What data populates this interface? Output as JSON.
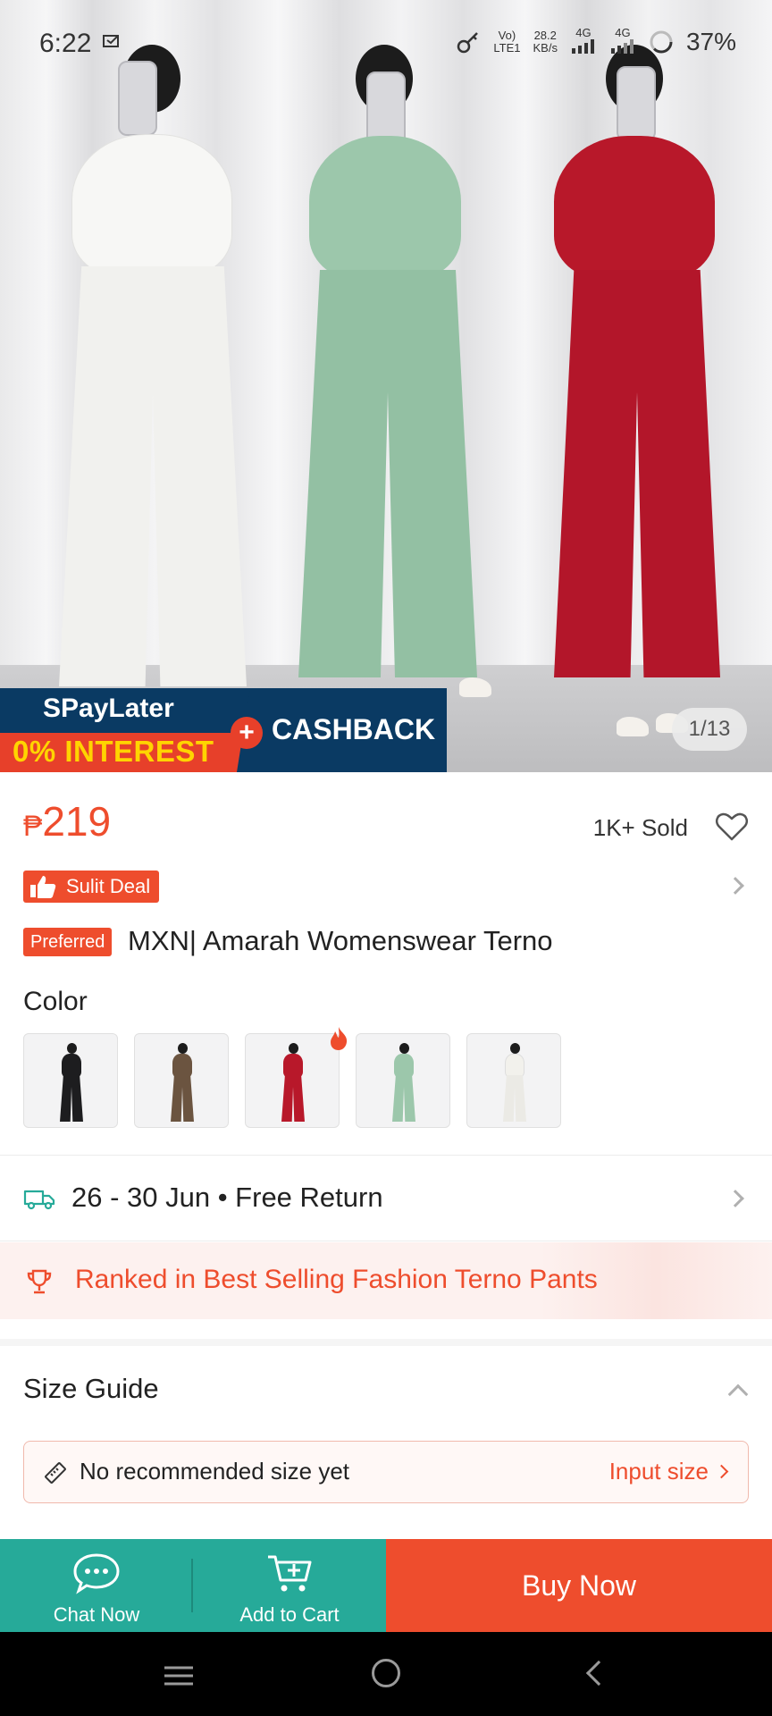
{
  "status_bar": {
    "time": "6:22",
    "volte_top": "Vo)",
    "volte_bottom": "LTE1",
    "speed_top": "28.2",
    "speed_bottom": "KB/s",
    "net1": "4G",
    "net2": "4G",
    "battery": "37%"
  },
  "hero": {
    "promo_spaylater": "SPayLater",
    "promo_interest": "0% INTEREST",
    "promo_plus": "+",
    "promo_cashback": "CASHBACK",
    "image_counter": "1/13",
    "variant_colors": [
      "#f7f7f5",
      "#9cc7ab",
      "#b8182a"
    ]
  },
  "product": {
    "currency": "₱",
    "price": "219",
    "sold": "1K+ Sold",
    "deal_label": "Sulit Deal",
    "preferred_label": "Preferred",
    "title": "MXN| Amarah Womenswear Terno",
    "color_label": "Color",
    "swatches": [
      {
        "name": "black",
        "color": "#1d1d1f"
      },
      {
        "name": "brown",
        "color": "#6b5440"
      },
      {
        "name": "red",
        "color": "#b8182a"
      },
      {
        "name": "mint",
        "color": "#9cc7ab"
      },
      {
        "name": "white",
        "color": "#f2f1ec"
      }
    ]
  },
  "delivery": {
    "text": "26 - 30 Jun • Free Return"
  },
  "ranking": {
    "text": "Ranked in Best Selling Fashion Terno Pants"
  },
  "size_guide": {
    "title": "Size Guide",
    "recommendation": "No recommended size yet",
    "input_link": "Input size"
  },
  "bottom_bar": {
    "chat_label": "Chat Now",
    "cart_label": "Add to Cart",
    "buy_label": "Buy Now"
  },
  "colors": {
    "accent": "#ee4d2d",
    "teal": "#26aa99",
    "promo_navy": "#0a3a63"
  },
  "icons": {
    "heart": "heart-icon",
    "deal": "thumbs-up-icon",
    "delivery": "truck-icon",
    "ranking": "trophy-icon",
    "size": "ruler-icon",
    "chat": "chat-bubble-icon",
    "cart": "cart-plus-icon"
  }
}
